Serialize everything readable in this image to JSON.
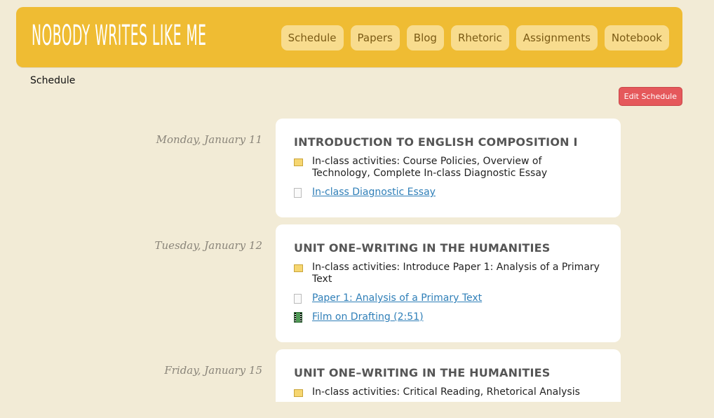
{
  "site": {
    "logo": "Nobody Writes Like Me"
  },
  "nav": {
    "items": [
      {
        "label": "Schedule"
      },
      {
        "label": "Papers"
      },
      {
        "label": "Blog"
      },
      {
        "label": "Rhetoric"
      },
      {
        "label": "Assignments"
      },
      {
        "label": "Notebook"
      }
    ]
  },
  "page": {
    "title": "Schedule",
    "edit_label": "Edit Schedule"
  },
  "colors": {
    "header": "#efbc33",
    "nav_button": "#f8dc8e",
    "edit_button": "#e5585b",
    "background": "#f2ebd6",
    "link": "#2f7fb8"
  },
  "schedule": [
    {
      "date": "Monday, January 11",
      "title": "INTRODUCTION TO ENGLISH COMPOSITION I",
      "items": [
        {
          "icon": "note-icon",
          "text": "In-class activities: Course Policies, Overview of Technology, Complete In-class Diagnostic Essay",
          "link": false
        },
        {
          "icon": "document-icon",
          "text": "In-class Diagnostic Essay",
          "link": true
        }
      ]
    },
    {
      "date": "Tuesday, January 12",
      "title": "UNIT ONE–WRITING IN THE HUMANITIES",
      "items": [
        {
          "icon": "note-icon",
          "text": "In-class activities: Introduce Paper 1: Analysis of a Primary Text",
          "link": false
        },
        {
          "icon": "document-icon",
          "text": "Paper 1: Analysis of a Primary Text",
          "link": true
        },
        {
          "icon": "film-icon",
          "text": "Film on Drafting (2:51)",
          "link": true
        }
      ]
    },
    {
      "date": "Friday, January 15",
      "title": "UNIT ONE–WRITING IN THE HUMANITIES",
      "items": [
        {
          "icon": "note-icon",
          "text": "In-class activities: Critical Reading, Rhetorical Analysis",
          "link": false
        }
      ]
    }
  ]
}
